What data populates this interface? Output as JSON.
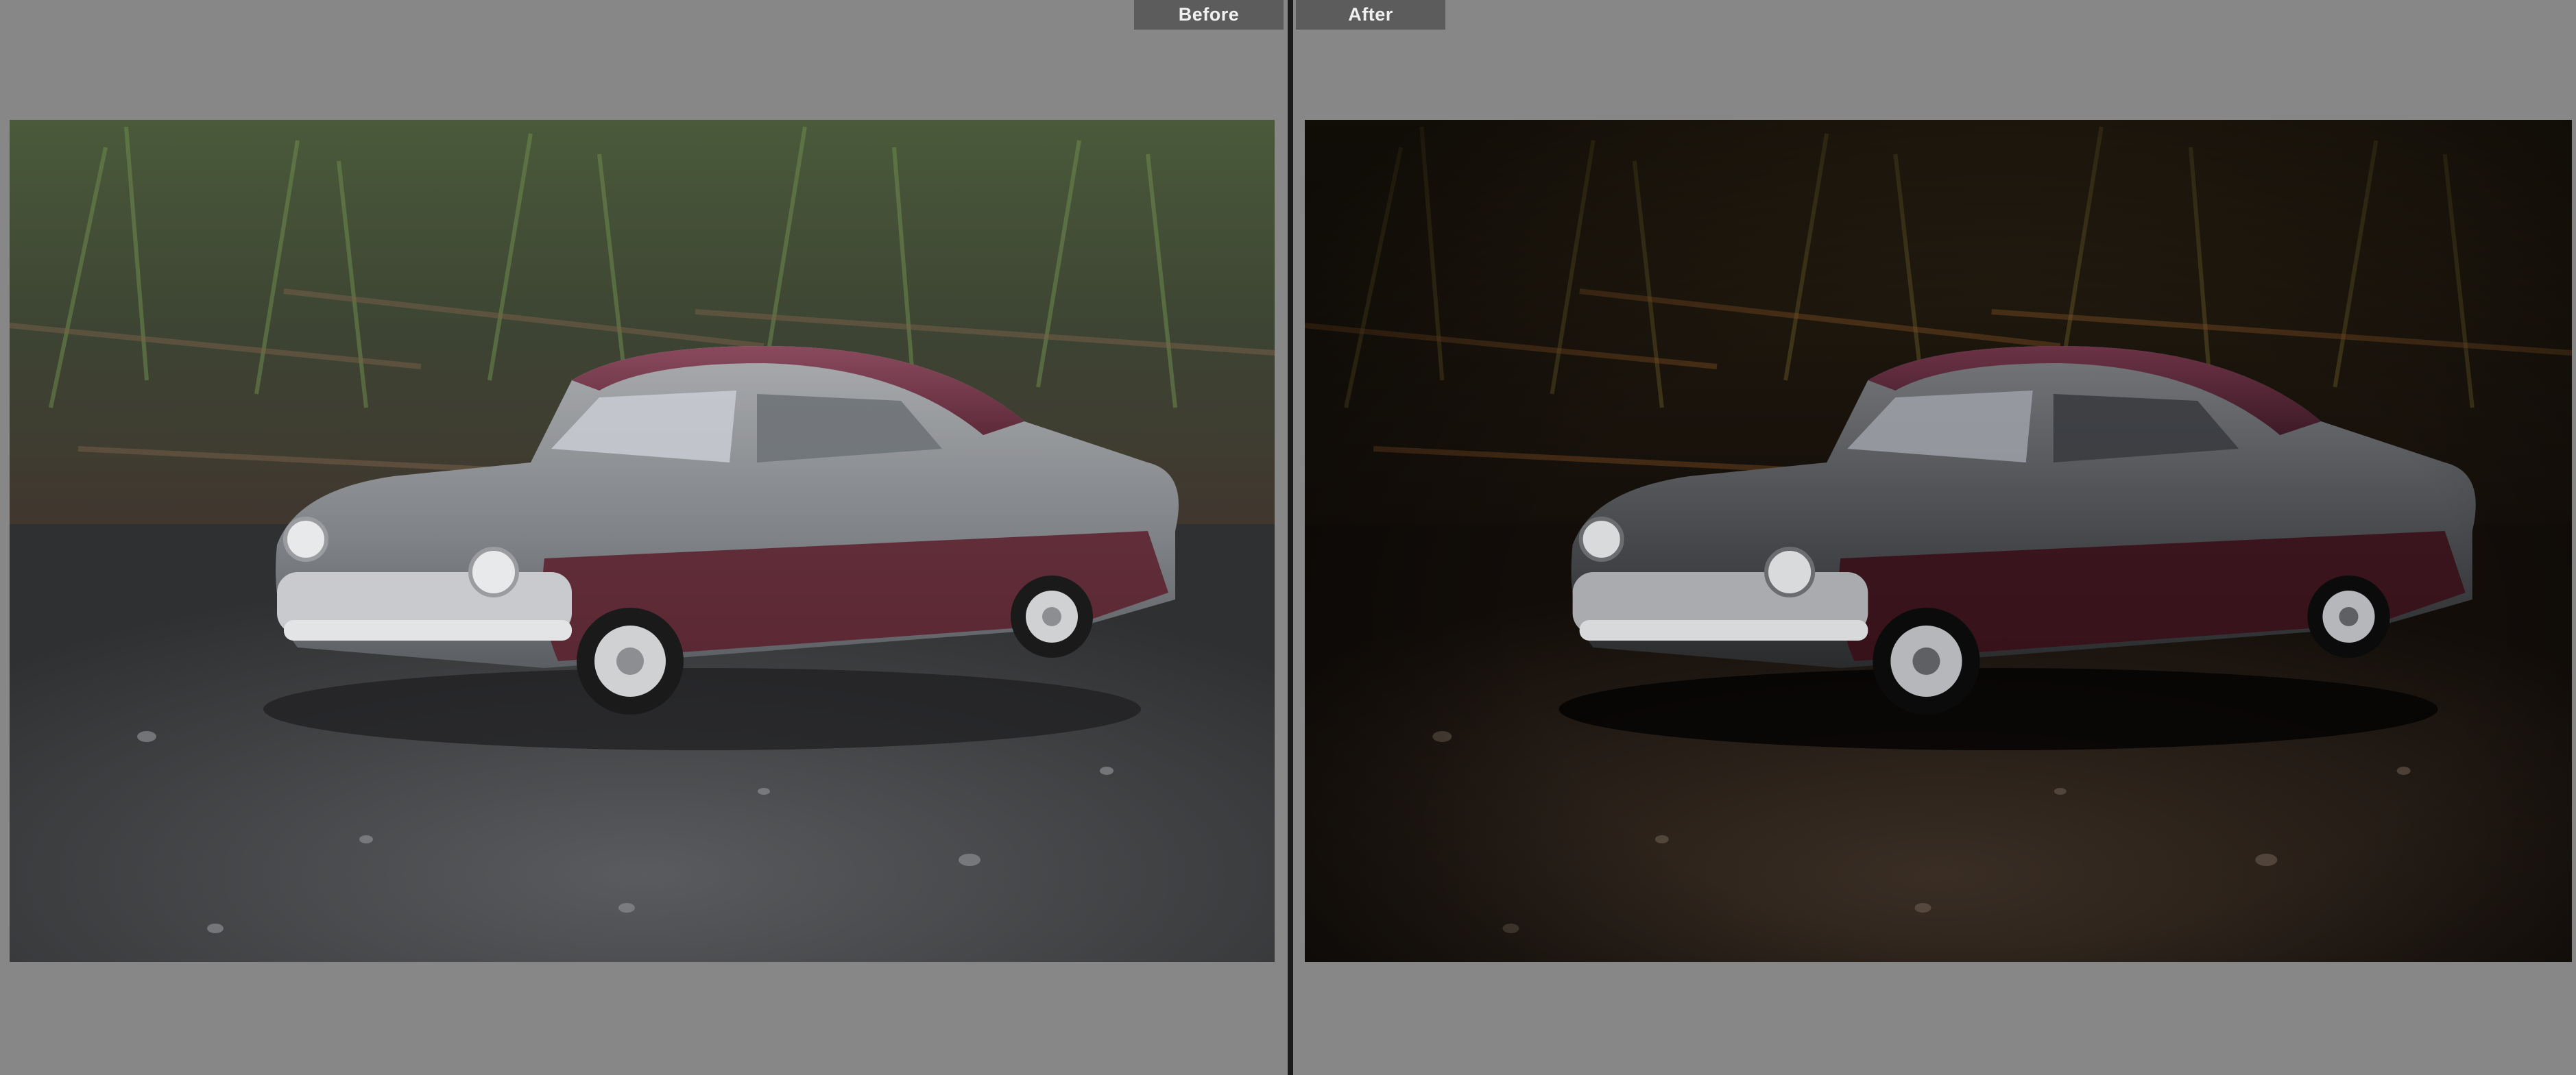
{
  "comparison": {
    "before_label": "Before",
    "after_label": "After"
  },
  "colors": {
    "background": "#878787",
    "tab_background": "#5c5c5c",
    "tab_text": "#f0f0f0",
    "divider": "#1b1b1b"
  },
  "images": {
    "before": {
      "subject": "toy-car-photo",
      "grade": "original"
    },
    "after": {
      "subject": "toy-car-photo",
      "grade": "dark-warm-edit"
    }
  }
}
